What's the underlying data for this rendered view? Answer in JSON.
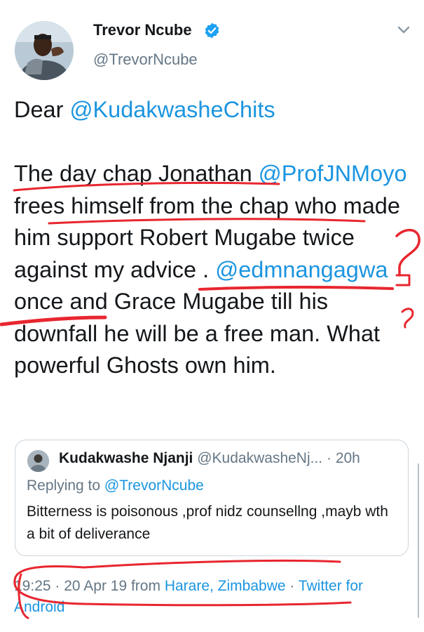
{
  "tweet": {
    "author_name": "Trevor Ncube",
    "author_handle": "@TrevorNcube",
    "line1_prefix": "Dear ",
    "line1_mention": "@KudakwasheChits",
    "para2_a": "The day chap Jonathan ",
    "para2_mention1": "@ProfJNMoyo",
    "para2_b": " frees himself from the chap who made him support Robert Mugabe twice against my advice . ",
    "para2_mention2": "@edmnangagwa",
    "para2_c": " once and Grace Mugabe till his downfall he will be a free man. What powerful Ghosts own him."
  },
  "quoted_tweet": {
    "author_name": "Kudakwashe Njanji",
    "author_handle": "@KudakwasheNj...",
    "separator": " · ",
    "time": "20h",
    "replying_prefix": "Replying to ",
    "replying_to": "@TrevorNcube",
    "text": "Bitterness is poisonous ,prof nidz counsellng ,mayb wth a bit of deliverance"
  },
  "meta": {
    "time": "19:25",
    "sep1": " · ",
    "date": "20 Apr 19",
    "from": " from ",
    "location": "Harare, Zimbabwe",
    "sep2": " · ",
    "client": "Twitter for Android"
  },
  "colors": {
    "link": "#1b95e0",
    "secondary": "#657786",
    "text": "#14171a",
    "annotation": "#e8262f",
    "verified": "#1da1f2"
  },
  "icons": {
    "verified": "verified-badge-icon",
    "menu": "chevron-down-icon"
  }
}
